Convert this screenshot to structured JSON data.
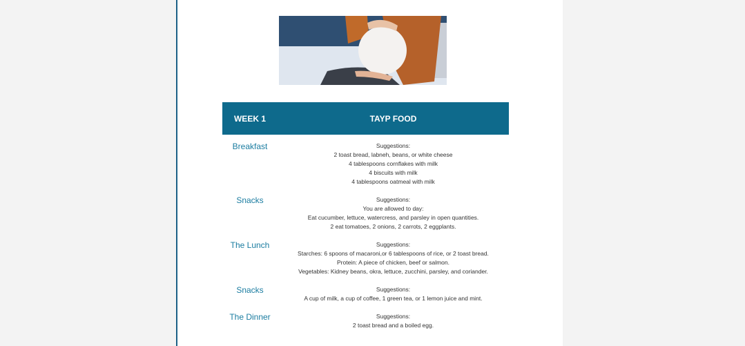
{
  "table": {
    "header": {
      "col1": "WEEK 1",
      "col2": "TAYP FOOD"
    },
    "rows": [
      {
        "meal": "Breakfast",
        "lines": [
          "Suggestions:",
          "2 toast bread, labneh, beans, or white cheese",
          "4 tablespoons cornflakes with milk",
          "4 biscuits with milk",
          "4 tablespoons oatmeal with milk"
        ]
      },
      {
        "meal": "Snacks",
        "lines": [
          "Suggestions:",
          "You are allowed to day:",
          "Eat cucumber, lettuce, watercress, and parsley in open quantities.",
          "2 eat tomatoes, 2 onions, 2 carrots, 2 eggplants."
        ]
      },
      {
        "meal": "The Lunch",
        "lines": [
          "Suggestions:",
          "Starches: 6 spoons of macaroni,or 6 tablespoons of rice, or 2 toast bread.",
          "Protein: A piece of chicken, beef or salmon.",
          "Vegetables: Kidney beans, okra, lettuce, zucchini, parsley, and coriander."
        ]
      },
      {
        "meal": "Snacks",
        "lines": [
          "Suggestions:",
          "A cup of milk, a cup of coffee, 1 green tea, or 1 lemon juice and mint."
        ]
      },
      {
        "meal": "The Dinner",
        "lines": [
          "Suggestions:",
          "2 toast bread and a boiled egg."
        ]
      }
    ]
  },
  "colors": {
    "header_bg": "#0e6a8c",
    "meal_text": "#1a7ca0",
    "page_border": "#1b5f86"
  }
}
